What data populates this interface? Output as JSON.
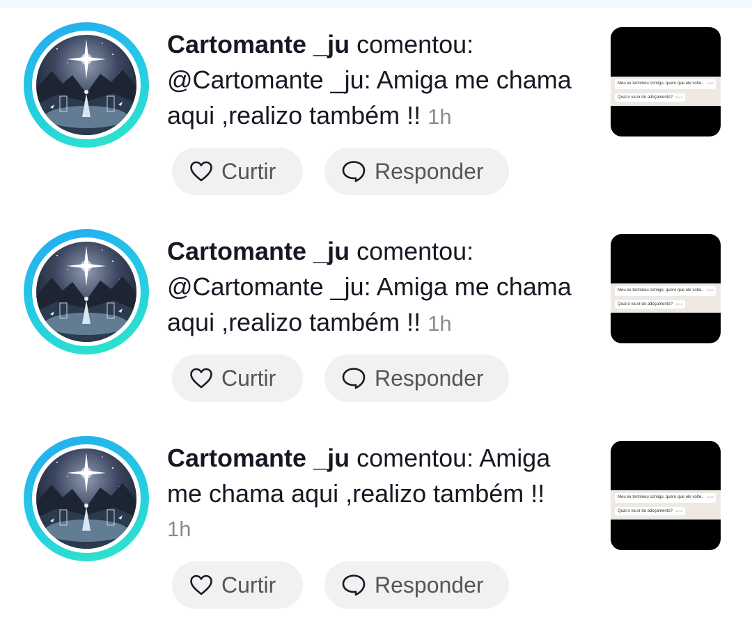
{
  "notifications": [
    {
      "username": "Cartomante _ju",
      "action": " comentou: ",
      "comment": "@Cartomante _ju: Amiga me chama aqui ,realizo também !! ",
      "time": "1h",
      "time_on_new_line": false,
      "like_label": "Curtir",
      "reply_label": "Responder",
      "thumb": {
        "msg1": "Meu ex terminou comigo, quero que ele volte..",
        "msg1_time": "13:15",
        "msg2": "Qual o va:or do adoçamento?",
        "msg2_time": "13:16"
      }
    },
    {
      "username": "Cartomante _ju",
      "action": " comentou: ",
      "comment": "@Cartomante _ju: Amiga me chama aqui ,realizo também !! ",
      "time": "1h",
      "time_on_new_line": false,
      "like_label": "Curtir",
      "reply_label": "Responder",
      "thumb": {
        "msg1": "Meu ex terminou comigo, quero que ele volte..",
        "msg1_time": "13:15",
        "msg2": "Qual o va:or do adoçamento?",
        "msg2_time": "13:16"
      }
    },
    {
      "username": "Cartomante _ju",
      "action": " comentou: ",
      "comment": "Amiga me chama aqui ,realizo também !!",
      "time": "1h",
      "time_on_new_line": true,
      "like_label": "Curtir",
      "reply_label": "Responder",
      "thumb": {
        "msg1": "Meu ex terminou comigo, quero que ele volte..",
        "msg1_time": "13:15",
        "msg2": "Qual o va:or do adoçamento?",
        "msg2_time": "13:16"
      }
    }
  ],
  "icons": {
    "like": "heart-outline-icon",
    "reply": "speech-bubble-icon"
  },
  "colors": {
    "avatar_ring_start": "#23a9f2",
    "avatar_ring_end": "#2ee8c8",
    "pill_background": "#f1f1f2",
    "time_text": "#8a8b91"
  }
}
